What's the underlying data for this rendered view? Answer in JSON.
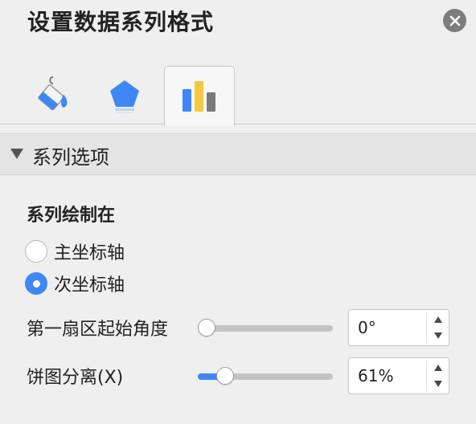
{
  "header": {
    "title": "设置数据系列格式",
    "close_icon": "close-icon"
  },
  "tabs": [
    {
      "icon": "paint-bucket-icon",
      "active": false
    },
    {
      "icon": "pentagon-icon",
      "active": false
    },
    {
      "icon": "bar-chart-icon",
      "active": true
    }
  ],
  "section": {
    "label": "系列选项",
    "expanded": true
  },
  "series_plot": {
    "title": "系列绘制在",
    "options": [
      {
        "label": "主坐标轴",
        "checked": false
      },
      {
        "label": "次坐标轴",
        "checked": true
      }
    ]
  },
  "first_slice_angle": {
    "label": "第一扇区起始角度",
    "value": "0°",
    "fraction": 0
  },
  "pie_explosion": {
    "label": "饼图分离(X)",
    "value": "61%",
    "fraction": 0.2
  },
  "colors": {
    "accent": "#3f87f5",
    "chart_blue": "#3f87f5",
    "chart_yellow": "#f5c842",
    "chart_gray": "#7a7a7a"
  }
}
